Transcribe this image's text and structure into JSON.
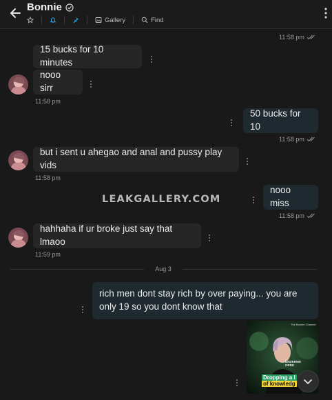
{
  "header": {
    "title": "Bonnie",
    "tools": [
      {
        "icon": "star-icon",
        "label": ""
      },
      {
        "icon": "bell-icon",
        "label": ""
      },
      {
        "icon": "pin-icon",
        "label": ""
      },
      {
        "icon": "gallery-icon",
        "label": "Gallery"
      },
      {
        "icon": "search-icon",
        "label": "Find"
      }
    ]
  },
  "colors": {
    "accent": "#2aa3e8",
    "incoming_bubble": "#262626",
    "outgoing_bubble": "#1e2a2f",
    "background": "#191919"
  },
  "messages": [
    {
      "time": "11:58 pm",
      "side": "out"
    },
    {
      "text": "15 bucks for 10 minutes",
      "side": "in"
    },
    {
      "text": "nooo sirr",
      "side": "in",
      "time": "11:58 pm"
    },
    {
      "text": "50 bucks for 10",
      "side": "out",
      "time": "11:58 pm"
    },
    {
      "text": "but i sent u ahegao and anal and pussy play vids",
      "side": "in",
      "time": "11:58 pm"
    },
    {
      "text": "nooo miss",
      "side": "out",
      "time": "11:58 pm"
    },
    {
      "text": "hahhaha if ur broke just say that lmaoo",
      "side": "in",
      "time": "11:59 pm"
    },
    {
      "text": "rich men dont stay rich by over paying... you are only 19 so you dont know that",
      "side": "out"
    }
  ],
  "date_separator": "Aug 3",
  "watermark": "LEAKGALLERY.COM",
  "video_thumbnail": {
    "brand": "The Bonnie Channel",
    "caption": [
      "Dropping a l",
      "of knowledg"
    ],
    "shirt_text": [
      "UNDERWE",
      "ORDE"
    ]
  }
}
